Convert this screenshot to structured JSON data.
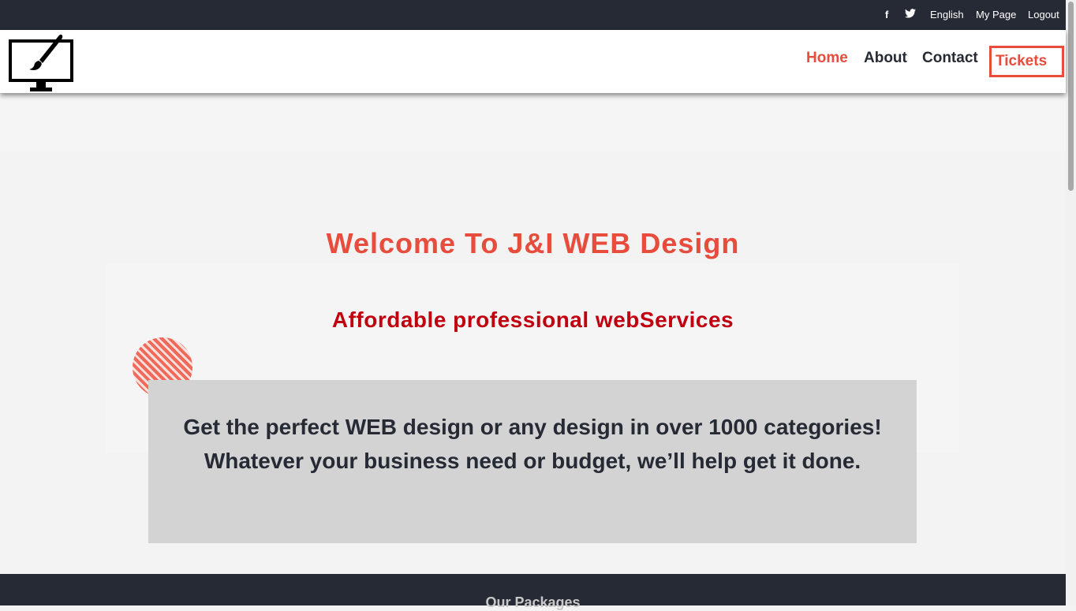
{
  "topbar": {
    "facebook_icon": "f",
    "twitter_icon": "t",
    "language": "English",
    "my_page": "My Page",
    "logout": "Logout"
  },
  "logo": {
    "icon": "monitor-brush-icon"
  },
  "nav": {
    "home": "Home",
    "about": "About",
    "contact": "Contact",
    "tickets": "Tickets"
  },
  "hero": {
    "welcome": "Welcome To J&I WEB Design",
    "subtitle": "Affordable professional webServices",
    "description": "Get the perfect WEB design or any design in over 1000 categories! Whatever your business need or budget, we’ll help get it done."
  },
  "packages": {
    "title": "Our Packages"
  },
  "colors": {
    "accent": "#e74c3c",
    "dark": "#262a35",
    "subtitle": "#c0000f"
  }
}
